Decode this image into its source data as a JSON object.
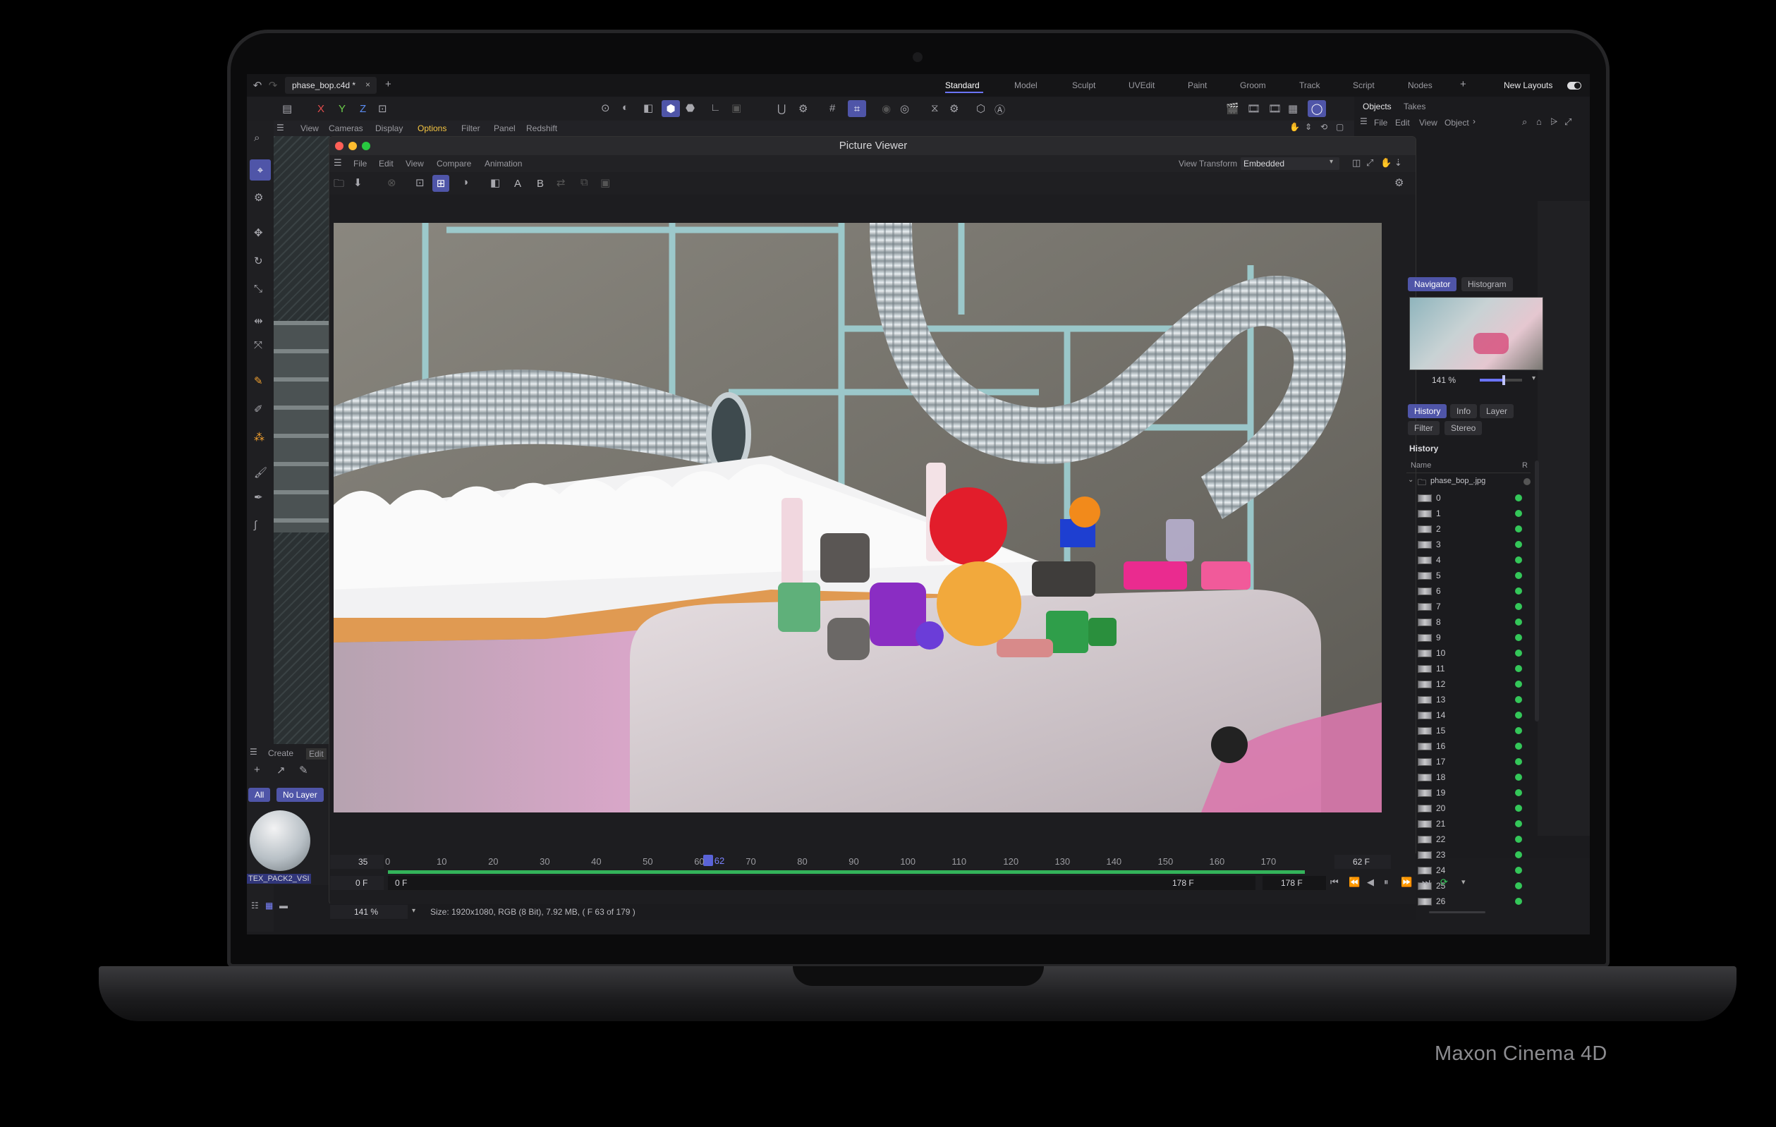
{
  "caption": "Maxon Cinema 4D",
  "file_tab": "phase_bop.c4d *",
  "layouts": [
    "Standard",
    "Model",
    "Sculpt",
    "UVEdit",
    "Paint",
    "Groom",
    "Track",
    "Script",
    "Nodes"
  ],
  "new_layouts": "New Layouts",
  "viewport_menu": [
    "View",
    "Cameras",
    "Display",
    "Options",
    "Filter",
    "Panel",
    "Redshift"
  ],
  "objects_tabs": [
    "Objects",
    "Takes"
  ],
  "objects_menu": [
    "File",
    "Edit",
    "View",
    "Object"
  ],
  "axis_labels": [
    "X",
    "Y",
    "Z"
  ],
  "picture_viewer": {
    "title": "Picture Viewer",
    "menu": [
      "File",
      "Edit",
      "View",
      "Compare",
      "Animation"
    ],
    "view_transform_label": "View Transform",
    "view_transform_value": "Embedded",
    "compare_a": "A",
    "compare_b": "B",
    "nav_tabs": [
      "Navigator",
      "Histogram"
    ],
    "zoom": "141 %",
    "zoom_fraction": 0.56,
    "tabs_row1": [
      "History",
      "Info",
      "Layer"
    ],
    "tabs_row2": [
      "Filter",
      "Stereo"
    ],
    "history_title": "History",
    "col_name": "Name",
    "col_r": "R",
    "root_item": "phase_bop_.jpg",
    "frames": [
      "0",
      "1",
      "2",
      "3",
      "4",
      "5",
      "6",
      "7",
      "8",
      "9",
      "10",
      "11",
      "12",
      "13",
      "14",
      "15",
      "16",
      "17",
      "18",
      "19",
      "20",
      "21",
      "22",
      "23",
      "24",
      "25",
      "26"
    ],
    "timeline_ticks": [
      "0",
      "10",
      "20",
      "30",
      "40",
      "50",
      "60",
      "70",
      "80",
      "90",
      "100",
      "110",
      "120",
      "130",
      "140",
      "150",
      "160",
      "170"
    ],
    "timeline_max": 178,
    "current_frame": "62",
    "current_frame_value": 62,
    "left_frame": "35",
    "right_frame": "62 F",
    "start_field": "0 F",
    "start_field2": "0 F",
    "end_field": "178 F",
    "end_field2": "178 F",
    "status_zoom": "141 %",
    "status_text": "Size: 1920x1080, RGB (8 Bit), 7.92 MB,  ( F 63 of 179 )"
  },
  "material_panel": {
    "menu": [
      "Create",
      "Edit"
    ],
    "filters": [
      "All",
      "No Layer"
    ],
    "material_name": "TEX_PACK2_VSI"
  }
}
